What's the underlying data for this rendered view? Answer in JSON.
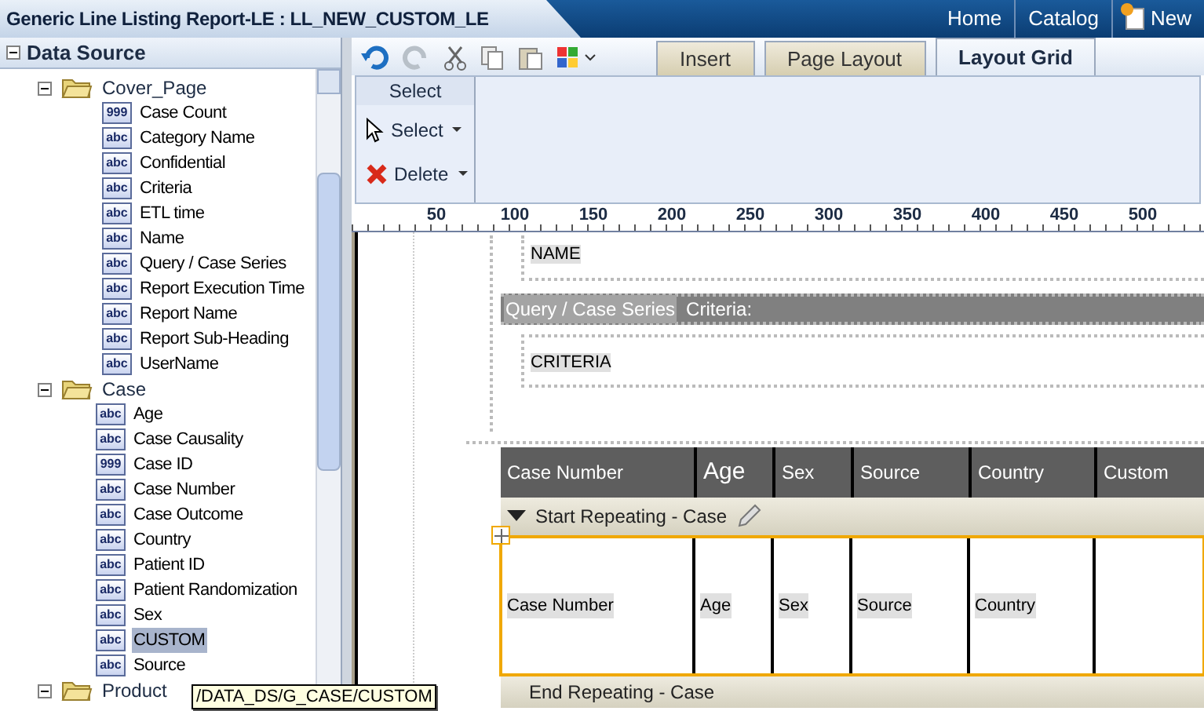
{
  "header": {
    "title": "Generic Line Listing Report-LE : LL_NEW_CUSTOM_LE",
    "links": [
      "Home",
      "Catalog",
      "New"
    ]
  },
  "sidebar": {
    "title": "Data Source",
    "tree": [
      {
        "label": "Cover_Page",
        "expanded": true,
        "children": [
          {
            "label": "Case Count",
            "icon": "999",
            "selected": false
          },
          {
            "label": "Category Name",
            "icon": "abc",
            "selected": false
          },
          {
            "label": "Confidential",
            "icon": "abc",
            "selected": false
          },
          {
            "label": "Criteria",
            "icon": "abc",
            "selected": false
          },
          {
            "label": "ETL time",
            "icon": "abc",
            "selected": false
          },
          {
            "label": "Name",
            "icon": "abc",
            "selected": false
          },
          {
            "label": "Query / Case Series",
            "icon": "abc",
            "selected": false
          },
          {
            "label": "Report Execution Time",
            "icon": "abc",
            "selected": false
          },
          {
            "label": "Report Name",
            "icon": "abc",
            "selected": false
          },
          {
            "label": "Report Sub-Heading",
            "icon": "abc",
            "selected": false
          },
          {
            "label": "UserName",
            "icon": "abc",
            "selected": false
          }
        ]
      },
      {
        "label": "Case",
        "expanded": true,
        "children": [
          {
            "label": "Age",
            "icon": "abc",
            "selected": false
          },
          {
            "label": "Case Causality",
            "icon": "abc",
            "selected": false
          },
          {
            "label": "Case ID",
            "icon": "999",
            "selected": false
          },
          {
            "label": "Case Number",
            "icon": "abc",
            "selected": false
          },
          {
            "label": "Case Outcome",
            "icon": "abc",
            "selected": false
          },
          {
            "label": "Country",
            "icon": "abc",
            "selected": false
          },
          {
            "label": "Patient ID",
            "icon": "abc",
            "selected": false
          },
          {
            "label": "Patient Randomization",
            "icon": "abc",
            "selected": false
          },
          {
            "label": "Sex",
            "icon": "abc",
            "selected": false
          },
          {
            "label": "CUSTOM",
            "icon": "abc",
            "selected": true
          },
          {
            "label": "Source",
            "icon": "abc",
            "selected": false
          }
        ]
      },
      {
        "label": "Product",
        "expanded": true
      }
    ],
    "tooltip": "/DATA_DS/G_CASE/CUSTOM"
  },
  "tabs": [
    {
      "label": "Insert",
      "selected": false
    },
    {
      "label": "Page Layout",
      "selected": false
    },
    {
      "label": "Layout Grid",
      "selected": true
    }
  ],
  "ribbon": {
    "group": "Select",
    "buttons": [
      {
        "kind": "select",
        "label": "Select"
      },
      {
        "kind": "delete",
        "label": "Delete"
      }
    ]
  },
  "ruler": [
    "50",
    "100",
    "150",
    "200",
    "250",
    "300",
    "350",
    "400",
    "450",
    "500"
  ],
  "canvas": {
    "name_field": "NAME",
    "bar_field": "Query / Case Series",
    "bar_label": "Criteria:",
    "criteria_field": "CRITERIA",
    "columns": [
      "Case Number",
      "Age",
      "Sex",
      "Source",
      "Country",
      "Custom"
    ],
    "start_repeat": "Start Repeating - Case",
    "cells": [
      "Case Number",
      "Age",
      "Sex",
      "Source",
      "Country"
    ],
    "end_repeat": "End Repeating - Case"
  }
}
